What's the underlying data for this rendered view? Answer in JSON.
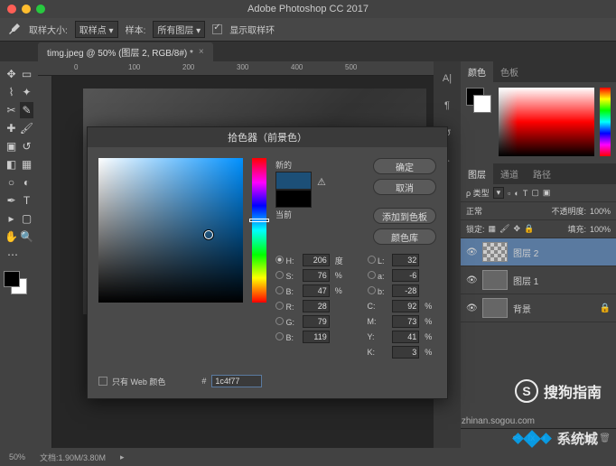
{
  "app_title": "Adobe Photoshop CC 2017",
  "options_bar": {
    "sample_size_label": "取样大小:",
    "sample_size_value": "取样点",
    "sample_label": "样本:",
    "sample_value": "所有图层",
    "show_ring_label": "显示取样环"
  },
  "document_tab": "timg.jpeg @ 50% (图层 2, RGB/8#) *",
  "ruler_marks": [
    "0",
    "100",
    "200",
    "300",
    "400",
    "500"
  ],
  "panels": {
    "color_tab": "颜色",
    "swatch_tab": "色板",
    "layers_tab": "图层",
    "channels_tab": "通道",
    "paths_tab": "路径",
    "kind_label": "类型",
    "blend_mode": "正常",
    "opacity_label": "不透明度:",
    "opacity_value": "100%",
    "lock_label": "锁定:",
    "fill_label": "填充:",
    "fill_value": "100%",
    "layers": [
      {
        "name": "图层 2"
      },
      {
        "name": "图层 1"
      },
      {
        "name": "背景"
      }
    ]
  },
  "status": {
    "zoom": "50%",
    "doc_size": "文档:1.90M/3.80M"
  },
  "color_picker": {
    "title": "拾色器（前景色）",
    "new_label": "新的",
    "current_label": "当前",
    "ok": "确定",
    "cancel": "取消",
    "add_swatch": "添加到色板",
    "color_lib": "颜色库",
    "web_only": "只有 Web 颜色",
    "new_color": "#1c4f77",
    "current_color": "#000000",
    "H": "206",
    "H_unit": "度",
    "S": "76",
    "S_unit": "%",
    "Bv": "47",
    "Bv_unit": "%",
    "L": "32",
    "a": "-6",
    "b": "-28",
    "R": "28",
    "G": "79",
    "B": "119",
    "C": "92",
    "C_unit": "%",
    "M": "73",
    "M_unit": "%",
    "Y": "41",
    "Y_unit": "%",
    "K": "3",
    "K_unit": "%",
    "hex": "1c4f77"
  },
  "watermarks": {
    "sogou": "搜狗指南",
    "sogou_url": "zhinan.sogou.com",
    "xtc": "系统城"
  }
}
